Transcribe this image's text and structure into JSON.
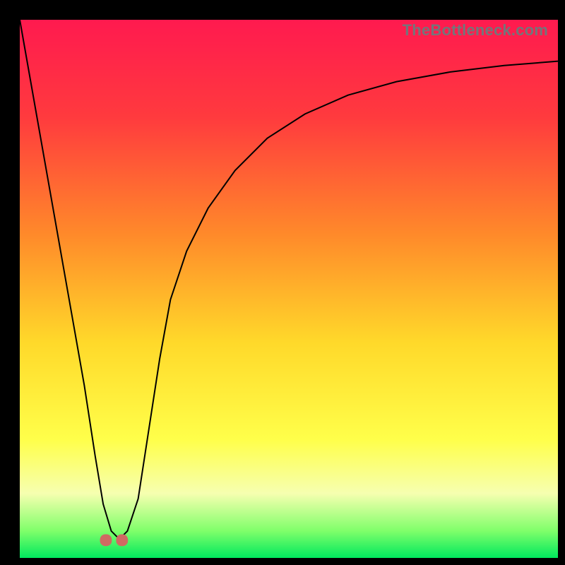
{
  "watermark": "TheBottleneck.com",
  "chart_data": {
    "type": "line",
    "title": "",
    "xlabel": "",
    "ylabel": "",
    "xlim": [
      0,
      100
    ],
    "ylim": [
      0,
      100
    ],
    "background_gradient": {
      "stops": [
        {
          "pos": 0.0,
          "color": "#ff1a4f"
        },
        {
          "pos": 0.18,
          "color": "#ff3a3e"
        },
        {
          "pos": 0.4,
          "color": "#ff8a2a"
        },
        {
          "pos": 0.6,
          "color": "#ffd92a"
        },
        {
          "pos": 0.78,
          "color": "#ffff4a"
        },
        {
          "pos": 0.88,
          "color": "#f6ffb0"
        },
        {
          "pos": 0.95,
          "color": "#7fff6a"
        },
        {
          "pos": 1.0,
          "color": "#00e85e"
        }
      ]
    },
    "series": [
      {
        "name": "bottleneck-curve",
        "stroke": "#000000",
        "x": [
          0,
          3,
          6,
          9,
          12,
          14,
          15.5,
          17,
          18.5,
          20,
          22,
          24,
          26,
          28,
          31,
          35,
          40,
          46,
          53,
          61,
          70,
          80,
          90,
          100
        ],
        "values": [
          100,
          83,
          66,
          49,
          32,
          19,
          10,
          5,
          3.5,
          5,
          11,
          24,
          37,
          48,
          57,
          65,
          72,
          78,
          82.5,
          86,
          88.5,
          90.3,
          91.5,
          92.3
        ]
      }
    ],
    "markers": [
      {
        "name": "trough-marker-left",
        "shape": "rounded-square",
        "x": 16.0,
        "y": 3.3,
        "size": 2.2,
        "fill": "#cf6a62"
      },
      {
        "name": "trough-marker-right",
        "shape": "rounded-square",
        "x": 19.0,
        "y": 3.3,
        "size": 2.2,
        "fill": "#cf6a62"
      }
    ]
  }
}
